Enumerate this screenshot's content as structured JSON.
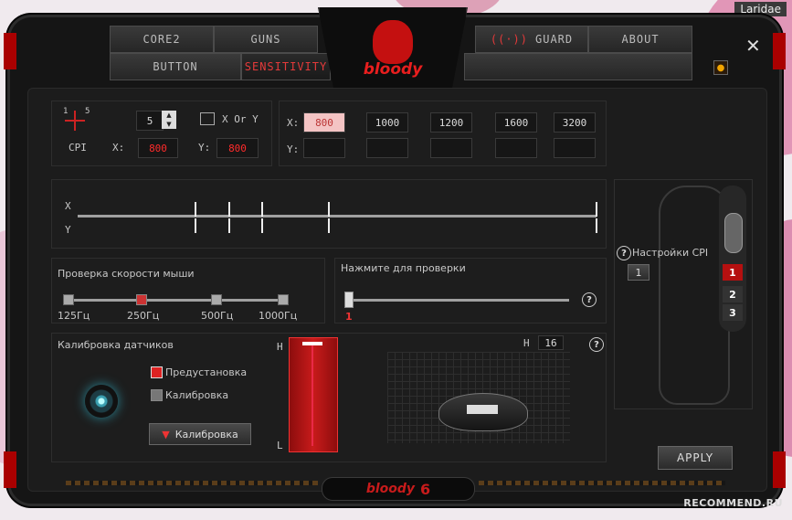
{
  "watermark": "Laridae",
  "watermark_bottom": "RECOMMEND.RU",
  "colors": {
    "accent": "#e43a3a",
    "panel": "#1d1d1d",
    "bg": "#151515"
  },
  "tabs": {
    "core2": "CORE2",
    "guns": "GUNS",
    "button": "BUTTON",
    "sensitivity": "SENSITIVITY",
    "guard": "GUARD",
    "about": "ABOUT"
  },
  "logo_text": "bloody",
  "cpi": {
    "levels_min": "1",
    "levels_max": "5",
    "level_value": "5",
    "xy_label": "X Or Y",
    "cpi_label": "CPI",
    "x_label": "X:",
    "y_label": "Y:",
    "x_value": "800",
    "y_value": "800"
  },
  "cpi_presets": {
    "x_label": "X:",
    "y_label": "Y:",
    "x_values": [
      "800",
      "1000",
      "1200",
      "1600",
      "3200"
    ],
    "y_values": [
      "",
      "",
      "",
      "",
      ""
    ]
  },
  "slider_axis": {
    "x": "X",
    "y": "Y"
  },
  "polling": {
    "title": "Проверка скорости мыши",
    "options": [
      "125Гц",
      "250Гц",
      "500Гц",
      "1000Гц"
    ],
    "selected": "250Гц"
  },
  "test": {
    "title": "Нажмите для проверки",
    "value": "1"
  },
  "calibration": {
    "title": "Калибровка датчиков",
    "preset_label": "Предустановка",
    "calibrate_label": "Калибровка",
    "button_label": "Калибровка",
    "gauge_high": "H",
    "gauge_low": "L"
  },
  "height": {
    "label": "H",
    "value": "16"
  },
  "mouse_panel": {
    "cpi_settings": "Настройки CPI",
    "cpi_index": "1",
    "buttons": [
      "1",
      "2",
      "3"
    ]
  },
  "apply_label": "APPLY",
  "footer_brand": "bloody",
  "footer_version": "6"
}
